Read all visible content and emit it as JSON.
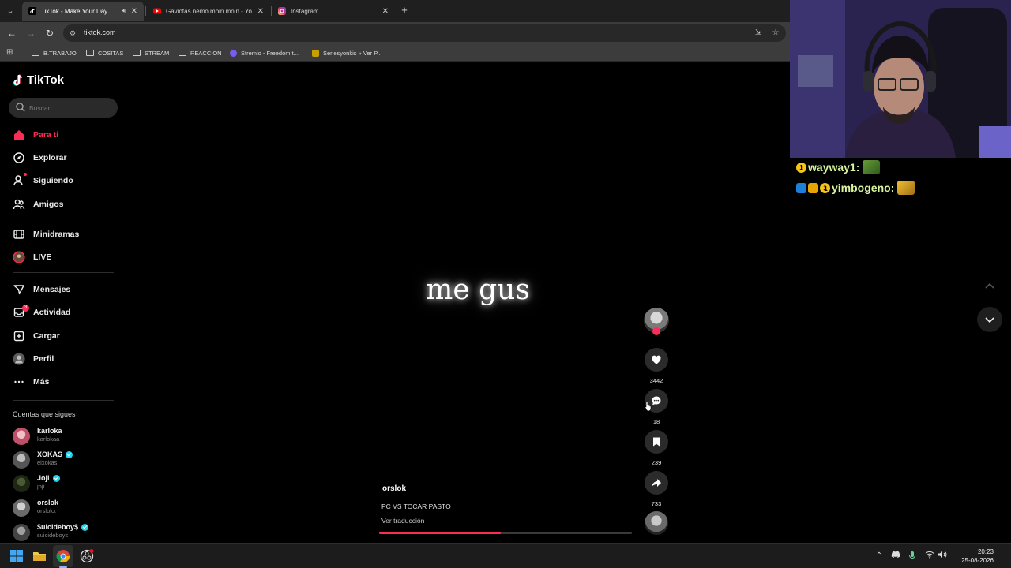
{
  "browser": {
    "tabs": [
      {
        "title": "TikTok - Make Your Day",
        "active": true,
        "favicon_color": "#000000",
        "audio": true
      },
      {
        "title": "Gaviotas nemo moin moin - Yo",
        "active": false,
        "favicon_color": "#ff0000"
      },
      {
        "title": "Instagram",
        "active": false,
        "favicon_color": "#e1306c"
      }
    ],
    "url": "tiktok.com",
    "bookmarks": [
      {
        "label": "B.TRABAJO",
        "type": "folder"
      },
      {
        "label": "COSITAS",
        "type": "folder"
      },
      {
        "label": "STREAM",
        "type": "folder"
      },
      {
        "label": "REACCION",
        "type": "folder"
      },
      {
        "label": "Stremio - Freedom t...",
        "type": "site",
        "color": "#7b5bf5"
      },
      {
        "label": "Seriesyonkis » Ver P...",
        "type": "site",
        "color": "#c8a000"
      }
    ]
  },
  "tiktok": {
    "logo": "TikTok",
    "search_placeholder": "Buscar",
    "nav": {
      "para_ti": "Para ti",
      "explorar": "Explorar",
      "siguiendo": "Siguiendo",
      "amigos": "Amigos",
      "minidramas": "Minidramas",
      "live": "LIVE",
      "mensajes": "Mensajes",
      "actividad": "Actividad",
      "actividad_badge": "3",
      "cargar": "Cargar",
      "perfil": "Perfil",
      "mas": "Más"
    },
    "following_title": "Cuentas que sigues",
    "following": [
      {
        "name": "karloka",
        "handle": "karlokaa",
        "verified": false,
        "avatar_color": "#c0506a"
      },
      {
        "name": "XOKAS",
        "handle": "elxokas",
        "verified": true,
        "avatar_color": "#555555"
      },
      {
        "name": "Joji",
        "handle": "joji",
        "verified": true,
        "avatar_color": "#2d3a1f"
      },
      {
        "name": "orslok",
        "handle": "orslokx",
        "verified": false,
        "avatar_color": "#6a6a6a"
      },
      {
        "name": "$uicideboy$",
        "handle": "suicideboys",
        "verified": true,
        "avatar_color": "#4a4a4a"
      }
    ],
    "video": {
      "overlay_text": "me gus",
      "author": "orslok",
      "description": "PC VS TOCAR PASTO",
      "translate": "Ver traducción",
      "progress": 0.48
    },
    "actions": {
      "likes": "3442",
      "comments": "18",
      "saves": "239",
      "shares": "733"
    }
  },
  "stream_overlay": {
    "chat": [
      {
        "user": "wayway1:"
      },
      {
        "user": "yimbogeno:"
      }
    ]
  },
  "taskbar": {
    "time": "20:23",
    "date": "25-08-2026"
  }
}
